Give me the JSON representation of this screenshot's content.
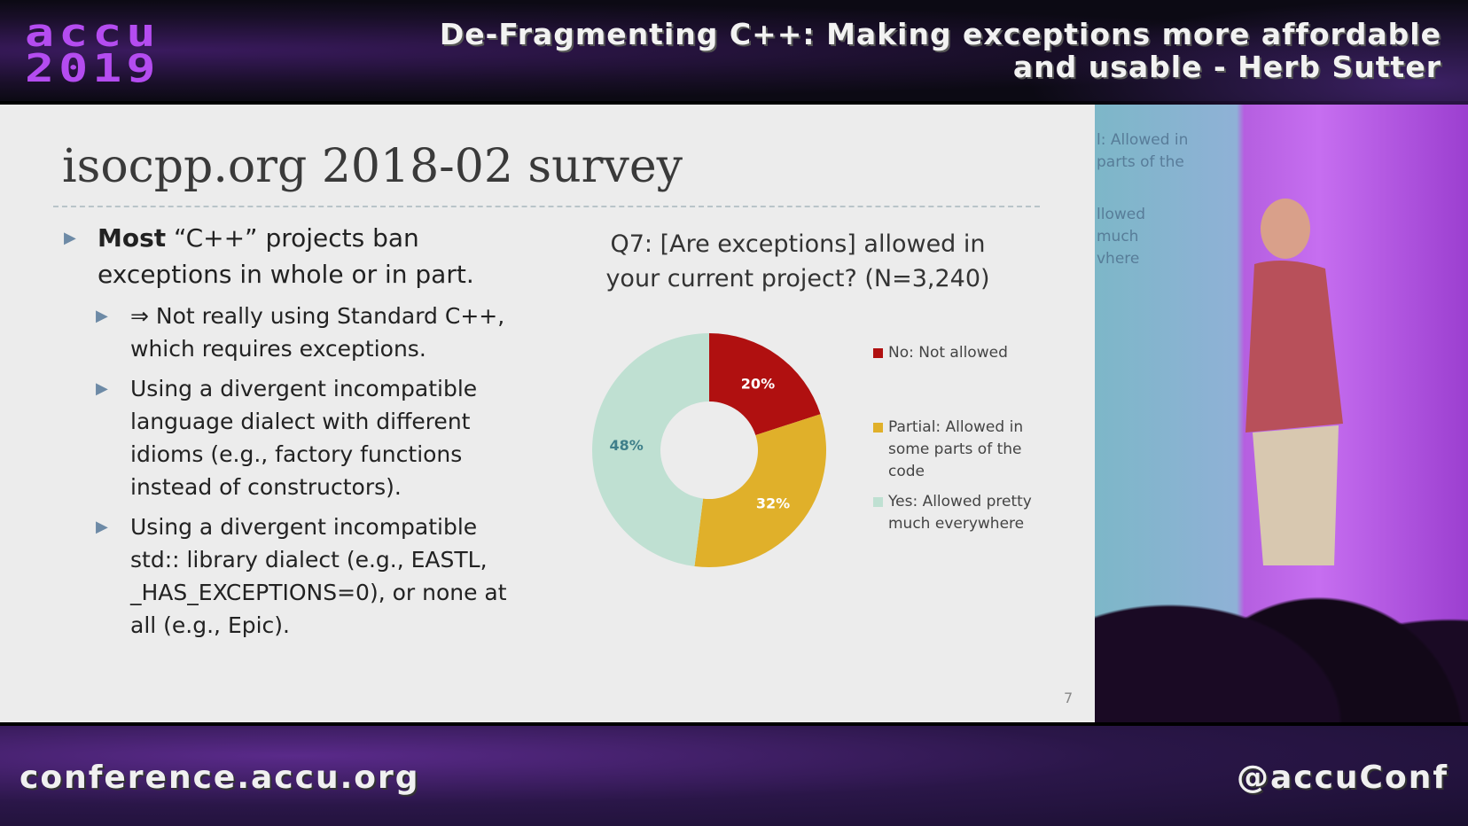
{
  "header": {
    "logo_line1": "accu",
    "logo_line2": "2019",
    "talk_title": "De-Fragmenting C++: Making exceptions more affordable and usable - Herb Sutter"
  },
  "slide": {
    "title": "isocpp.org 2018-02 survey",
    "bullet_main_bold": "Most",
    "bullet_main_rest": " “C++” projects ban exceptions in whole or in part.",
    "sub_bullets": [
      "⇒ Not really using Standard C++, which requires exceptions.",
      "Using a divergent incompatible language dialect with different idioms (e.g., factory functions instead of constructors).",
      "Using a divergent incompatible std:: library dialect (e.g., EASTL, _HAS_EXCEPTIONS=0), or none at all (e.g., Epic)."
    ],
    "page_number": "7"
  },
  "chart_data": {
    "type": "pie",
    "donut": true,
    "title": "Q7: [Are exceptions] allowed in your current project? (N=3,240)",
    "categories": [
      "No: Not allowed",
      "Partial: Allowed in some parts of the code",
      "Yes: Allowed pretty much everywhere"
    ],
    "values": [
      20,
      32,
      48
    ],
    "labels": [
      "20%",
      "32%",
      "48%"
    ],
    "colors": [
      "#b01010",
      "#e0b02a",
      "#bfe0d2"
    ],
    "label_colors": [
      "#ffffff",
      "#ffffff",
      "#3f7f8a"
    ],
    "legend_position": "right"
  },
  "video": {
    "screen_text": [
      "l: Allowed in",
      "parts of the",
      "llowed",
      "much",
      "vhere"
    ]
  },
  "footer": {
    "site": "conference.accu.org",
    "handle": "@accuConf"
  }
}
